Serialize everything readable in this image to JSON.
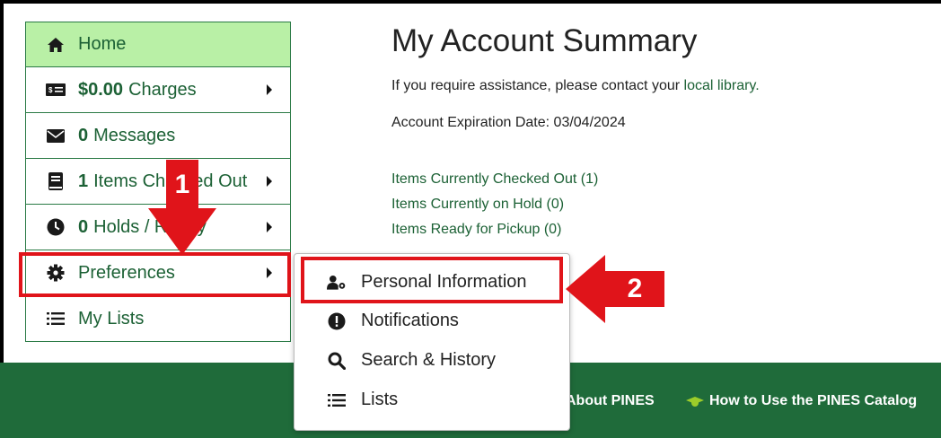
{
  "sidebar": {
    "home": "Home",
    "charges_amount": "$0.00",
    "charges_label": "Charges",
    "messages_count": "0",
    "messages_label": "Messages",
    "checked_count": "1",
    "checked_label": "Items Checked Out",
    "holds_count": "0",
    "holds_label": "Holds / Ready",
    "preferences": "Preferences",
    "lists": "My Lists"
  },
  "main": {
    "title": "My Account Summary",
    "assist_text": "If you require assistance, please contact your",
    "assist_link": "local library.",
    "expiration": "Account Expiration Date: 03/04/2024",
    "links": [
      "Items Currently Checked Out (1)",
      "Items Currently on Hold (0)",
      "Items Ready for Pickup (0)"
    ]
  },
  "dropdown": {
    "items": [
      "Personal Information",
      "Notifications",
      "Search & History",
      "Lists"
    ]
  },
  "footer": {
    "about": "About PINES",
    "howto": "How to Use the PINES Catalog"
  },
  "annotations": {
    "step1": "1",
    "step2": "2",
    "highlight_color": "#e0141a"
  },
  "colors": {
    "brand_green": "#1f6b3a",
    "home_bg": "#b9f0a6",
    "link_green": "#1c6135"
  }
}
